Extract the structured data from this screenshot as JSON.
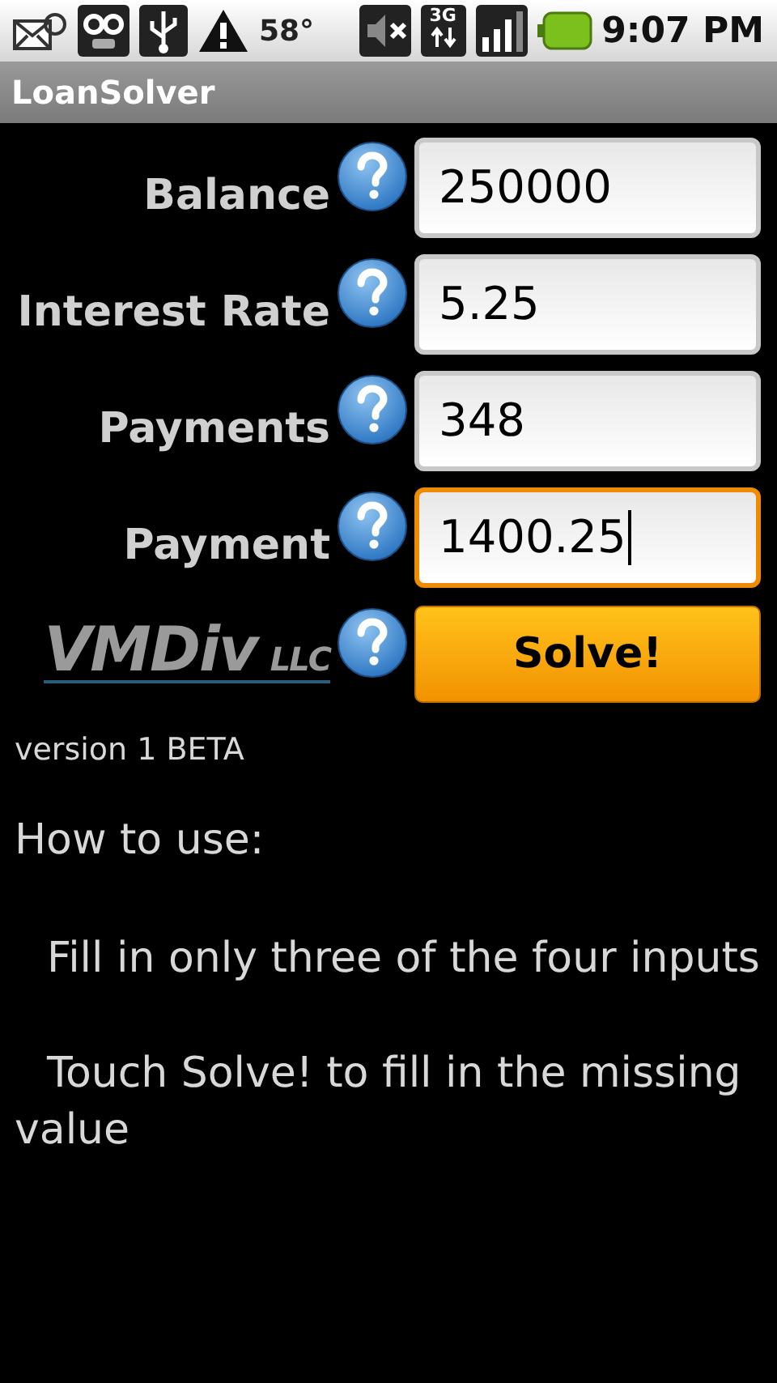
{
  "status_bar": {
    "temperature": "58°",
    "time": "9:07 PM",
    "network": "3G"
  },
  "app_bar": {
    "title": "LoanSolver"
  },
  "fields": [
    {
      "label": "Balance",
      "value": "250000",
      "focused": false
    },
    {
      "label": "Interest Rate",
      "value": "5.25",
      "focused": false
    },
    {
      "label": "Payments",
      "value": "348",
      "focused": false
    },
    {
      "label": "Payment",
      "value": "1400.25",
      "focused": true
    }
  ],
  "logo": {
    "name": "VMDiv",
    "suffix": "LLC"
  },
  "solve_button": {
    "label": "Solve!"
  },
  "version": "version 1 BETA",
  "help": {
    "heading": "How to use:",
    "steps": [
      "Fill in only three of the four inputs",
      "Touch Solve! to fill in the missing value"
    ]
  }
}
